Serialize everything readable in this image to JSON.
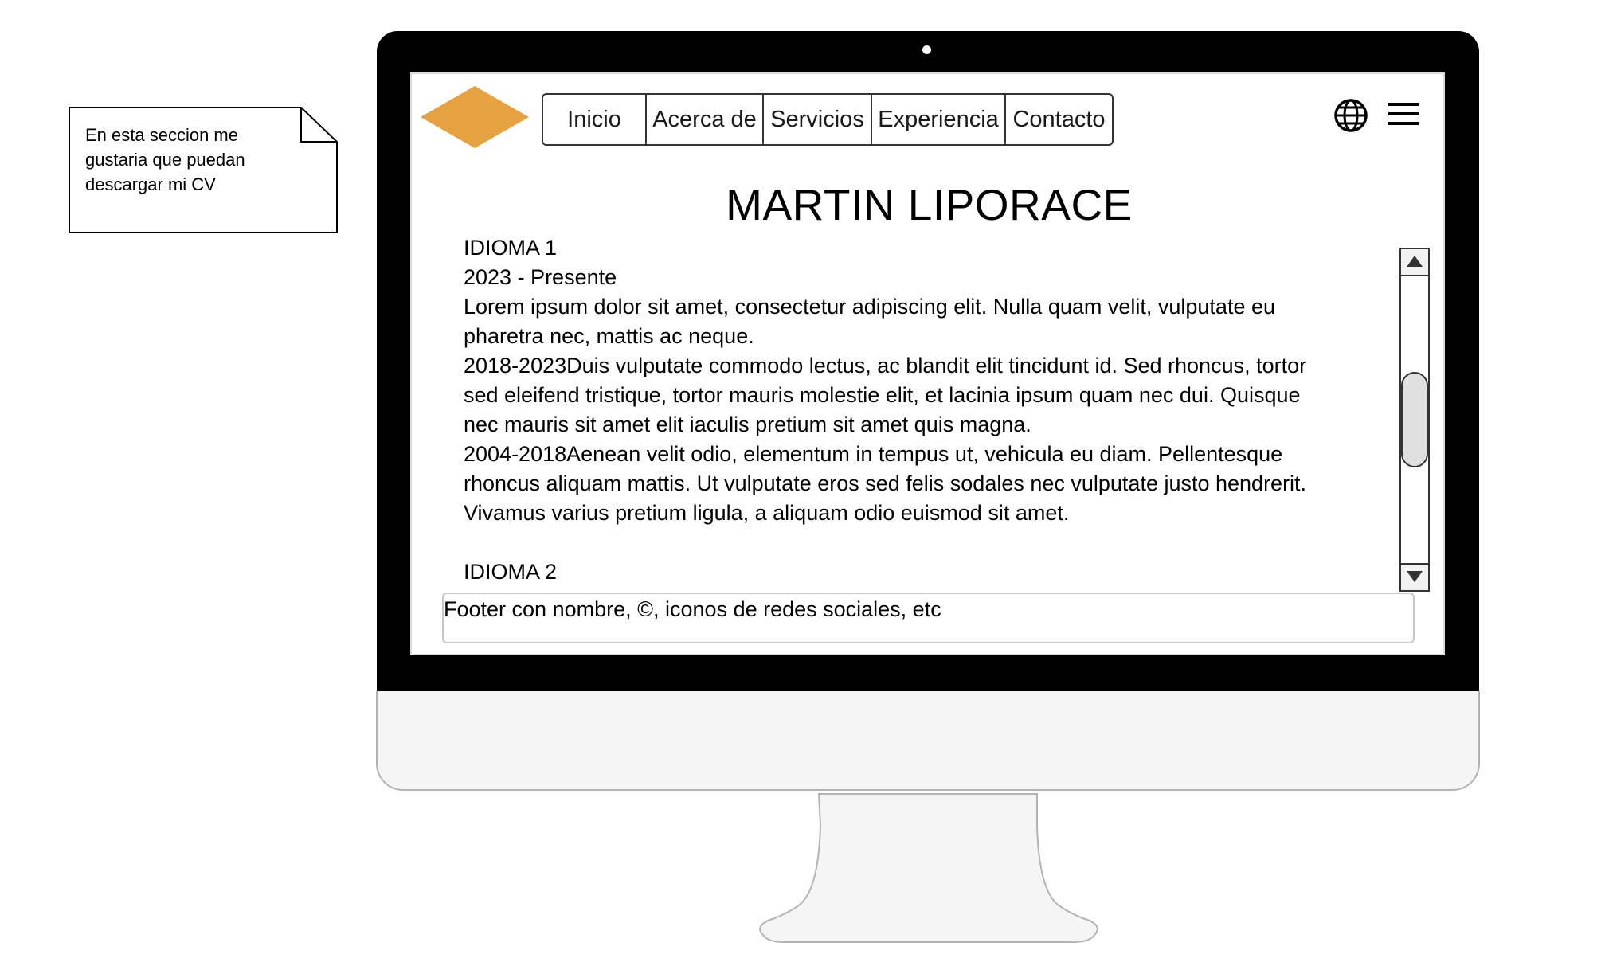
{
  "note": {
    "lines": [
      "En esta seccion me",
      "gustaria que puedan",
      "descargar mi CV"
    ]
  },
  "nav": {
    "items": [
      {
        "label": "Inicio"
      },
      {
        "label": "Acerca de"
      },
      {
        "label": "Servicios"
      },
      {
        "label": "Experiencia"
      },
      {
        "label": "Contacto"
      }
    ]
  },
  "header": {
    "logo_color": "#e6a141",
    "globe_icon": "globe-icon",
    "menu_icon": "hamburger-menu-icon"
  },
  "page": {
    "title": "MARTIN LIPORACE"
  },
  "content": {
    "lines": [
      "IDIOMA 1",
      "2023 - Presente",
      "Lorem ipsum dolor sit amet, consectetur adipiscing elit. Nulla quam velit, vulputate eu",
      "pharetra nec, mattis ac neque.",
      "2018-2023Duis vulputate commodo lectus, ac blandit elit tincidunt id. Sed rhoncus, tortor",
      "sed eleifend tristique, tortor mauris molestie elit, et lacinia ipsum quam nec dui. Quisque",
      "nec mauris sit amet elit iaculis pretium sit amet quis magna.",
      "2004-2018Aenean velit odio, elementum in tempus ut, vehicula eu diam. Pellentesque",
      "rhoncus aliquam mattis. Ut vulputate eros sed felis sodales nec vulputate justo hendrerit.",
      "Vivamus varius pretium ligula, a aliquam odio euismod sit amet.",
      "",
      "IDIOMA 2"
    ]
  },
  "footer": {
    "text": "Footer con nombre, ©, iconos de redes sociales, etc"
  }
}
